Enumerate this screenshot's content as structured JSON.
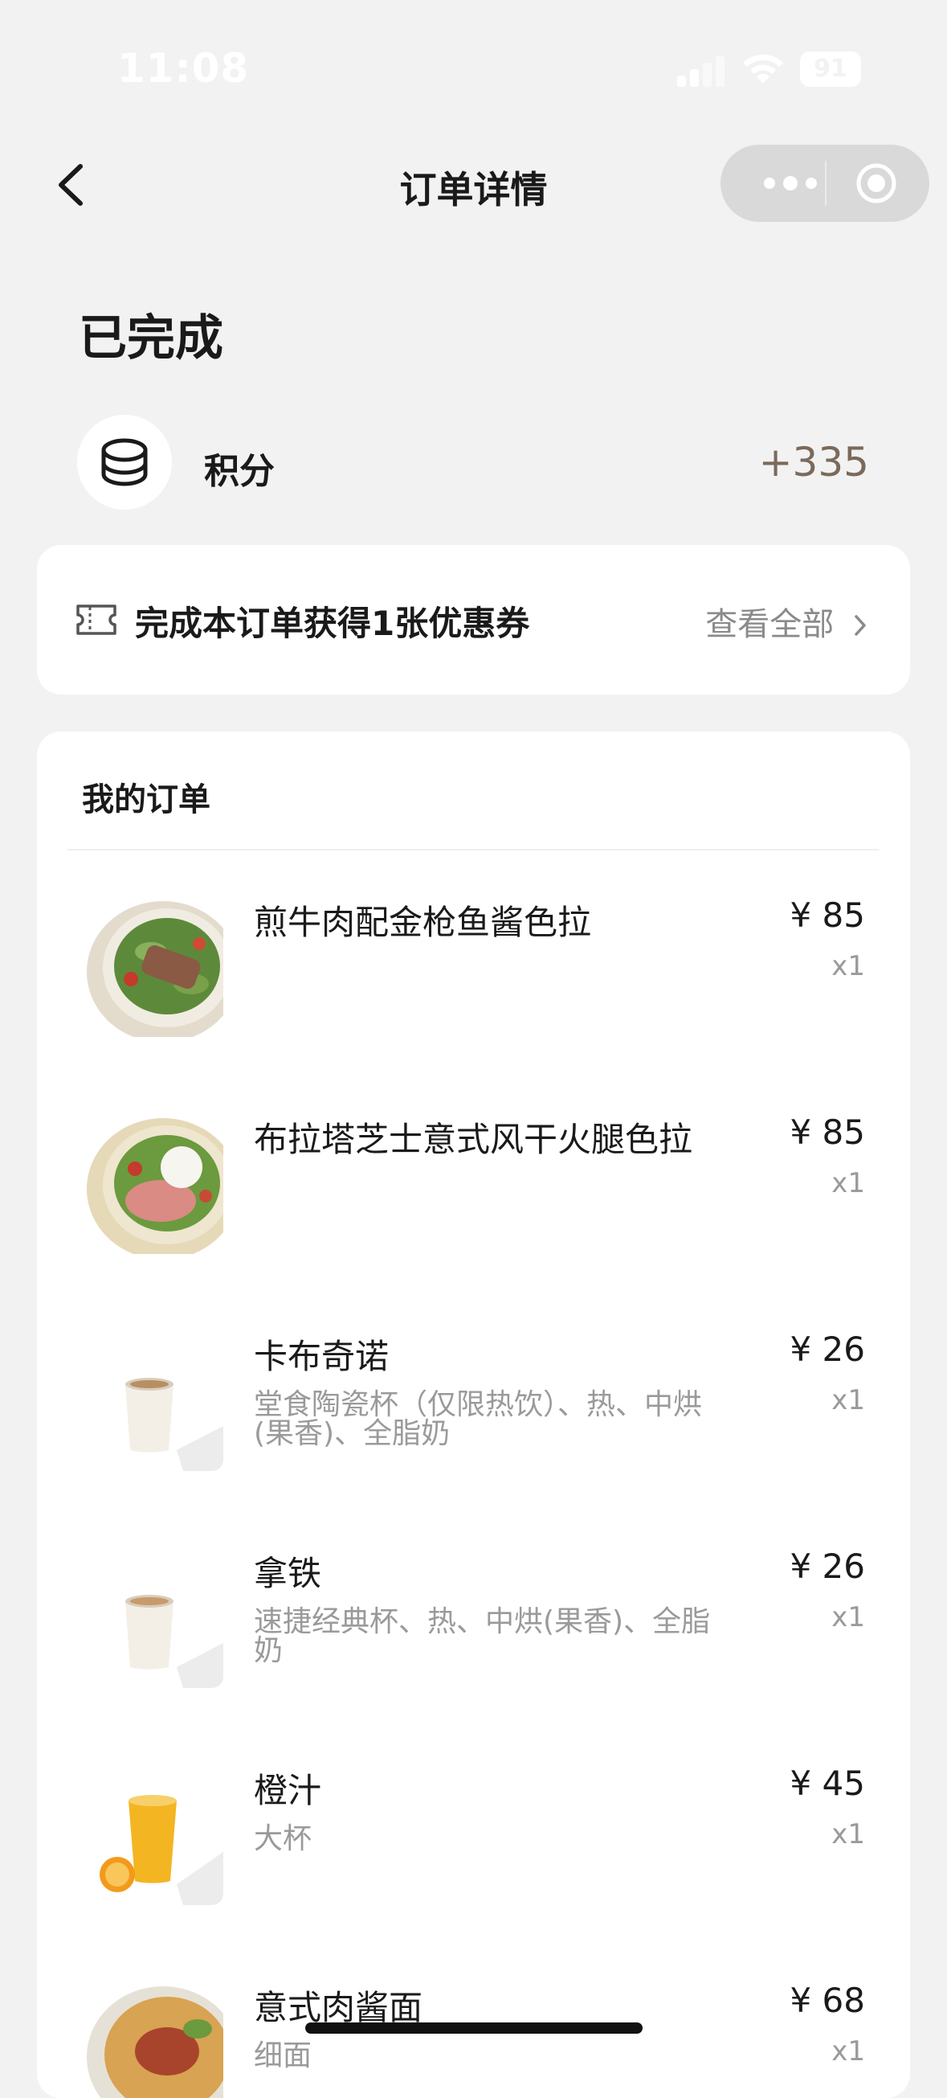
{
  "status_bar": {
    "time": "11:08",
    "battery": "91"
  },
  "nav": {
    "title": "订单详情"
  },
  "order_status": "已完成",
  "points": {
    "label": "积分",
    "value": "+335"
  },
  "coupon": {
    "text": "完成本订单获得1张优惠券",
    "view_all": "查看全部"
  },
  "orders": {
    "title": "我的订单",
    "items": [
      {
        "name": "煎牛肉配金枪鱼酱色拉",
        "spec": "",
        "price": "¥ 85",
        "qty": "x1",
        "image": "salad-beef"
      },
      {
        "name": "布拉塔芝士意式风干火腿色拉",
        "spec": "",
        "price": "¥ 85",
        "qty": "x1",
        "image": "salad-burrata"
      },
      {
        "name": "卡布奇诺",
        "spec": "堂食陶瓷杯（仅限热饮）、热、中烘(果香)、全脂奶",
        "price": "¥ 26",
        "qty": "x1",
        "image": "coffee-cup"
      },
      {
        "name": "拿铁",
        "spec": "速捷经典杯、热、中烘(果香)、全脂奶",
        "price": "¥ 26",
        "qty": "x1",
        "image": "coffee-cup"
      },
      {
        "name": "橙汁",
        "spec": "大杯",
        "price": "¥ 45",
        "qty": "x1",
        "image": "orange-juice"
      },
      {
        "name": "意式肉酱面",
        "spec": "细面",
        "price": "¥ 68",
        "qty": "x1",
        "image": "pasta"
      }
    ]
  }
}
